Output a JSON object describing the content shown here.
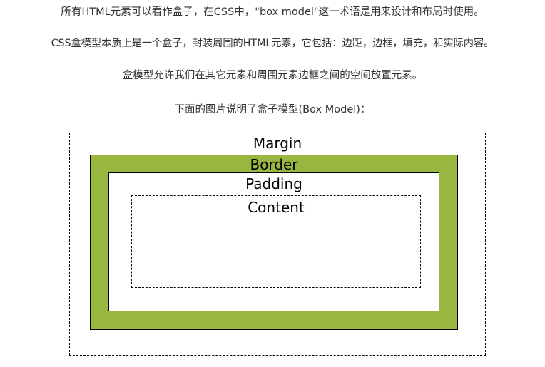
{
  "paragraphs": {
    "intro": "所有HTML元素可以看作盒子，在CSS中，\"box model\"这一术语是用来设计和布局时使用。",
    "definition": "CSS盒模型本质上是一个盒子，封装周围的HTML元素，它包括：边距，边框，填充，和实际内容。",
    "purpose": "盒模型允许我们在其它元素和周围元素边框之间的空间放置元素。",
    "caption": "下面的图片说明了盒子模型(Box Model)："
  },
  "diagram": {
    "margin_label": "Margin",
    "border_label": "Border",
    "padding_label": "Padding",
    "content_label": "Content",
    "border_color": "#98b640",
    "line_color": "#000000"
  }
}
